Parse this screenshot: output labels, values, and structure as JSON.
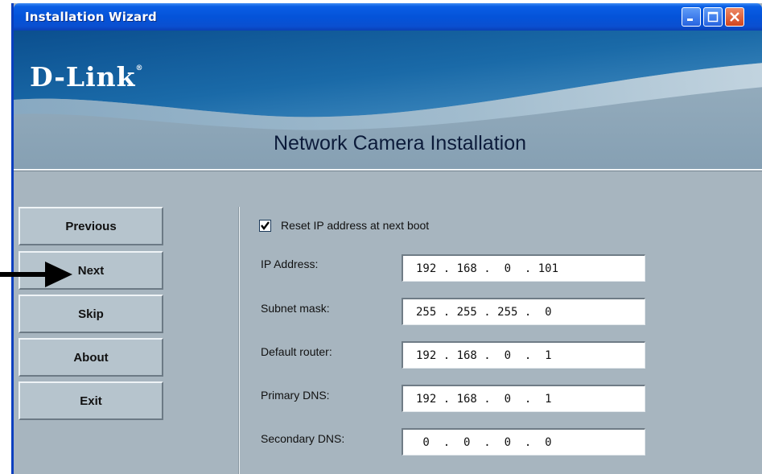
{
  "window": {
    "title": "Installation Wizard",
    "buttons": [
      "minimize",
      "maximize",
      "close"
    ]
  },
  "banner": {
    "logo": "D-Link",
    "logo_mark": "®",
    "heading": "Network Camera Installation"
  },
  "nav": {
    "buttons": [
      "Previous",
      "Next",
      "Skip",
      "About",
      "Exit"
    ],
    "pointer_target": "Next"
  },
  "form": {
    "reset_checkbox": {
      "label": "Reset IP address at next boot",
      "checked": true
    },
    "fields": [
      {
        "label": "IP Address:",
        "value": "192 . 168 .  0  . 101"
      },
      {
        "label": "Subnet mask:",
        "value": "255 . 255 . 255 .  0"
      },
      {
        "label": "Default router:",
        "value": "192 . 168 .  0  .  1"
      },
      {
        "label": "Primary DNS:",
        "value": "192 . 168 .  0  .  1"
      },
      {
        "label": "Secondary DNS:",
        "value": " 0  .  0  .  0  .  0"
      }
    ]
  },
  "colors": {
    "titlebar": "#0453d9",
    "panel": "#a7b5bf",
    "close_button": "#d2451e"
  }
}
